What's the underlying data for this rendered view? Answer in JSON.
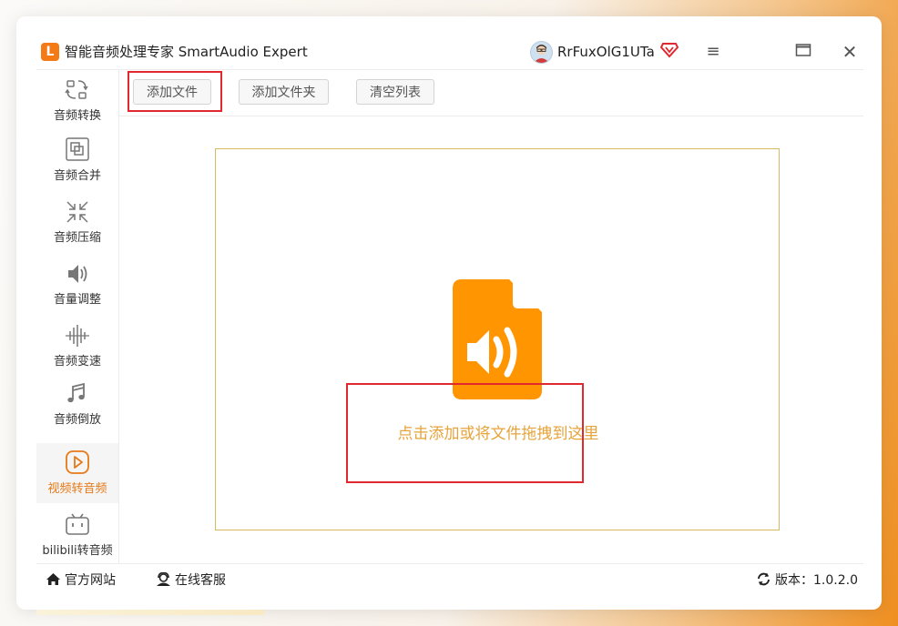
{
  "window": {
    "title": "智能音频处理专家 SmartAudio Expert",
    "logo_letter": "L",
    "accent_color": "#f47a16"
  },
  "user": {
    "name": "RrFuxOlG1UTa",
    "vip_icon": "vip-diamond-icon",
    "vip_color": "#e0282e"
  },
  "window_controls": {
    "menu_glyph": "≡",
    "maximize_glyph": "▭",
    "close_glyph": "✕"
  },
  "sidebar": {
    "items": [
      {
        "label": "音频转换",
        "icon": "audio-convert-icon"
      },
      {
        "label": "音频合并",
        "icon": "audio-merge-icon"
      },
      {
        "label": "音频压缩",
        "icon": "audio-compress-icon"
      },
      {
        "label": "音量调整",
        "icon": "volume-icon"
      },
      {
        "label": "音频变速",
        "icon": "audio-speed-icon"
      },
      {
        "label": "音频倒放",
        "icon": "music-note-icon"
      },
      {
        "label": "视频转音频",
        "icon": "video-play-icon",
        "active": true
      },
      {
        "label": "bilibili转音频",
        "icon": "bilibili-tv-icon"
      }
    ]
  },
  "toolbar": {
    "add_file": "添加文件",
    "add_folder": "添加文件夹",
    "clear_list": "清空列表"
  },
  "dropzone": {
    "icon": "audio-file-icon",
    "text": "点击添加或将文件拖拽到这里",
    "icon_color": "#ff9500",
    "text_color": "#e7a33b"
  },
  "footer": {
    "website": "官方网站",
    "support": "在线客服",
    "version": "版本：1.0.2.0"
  }
}
